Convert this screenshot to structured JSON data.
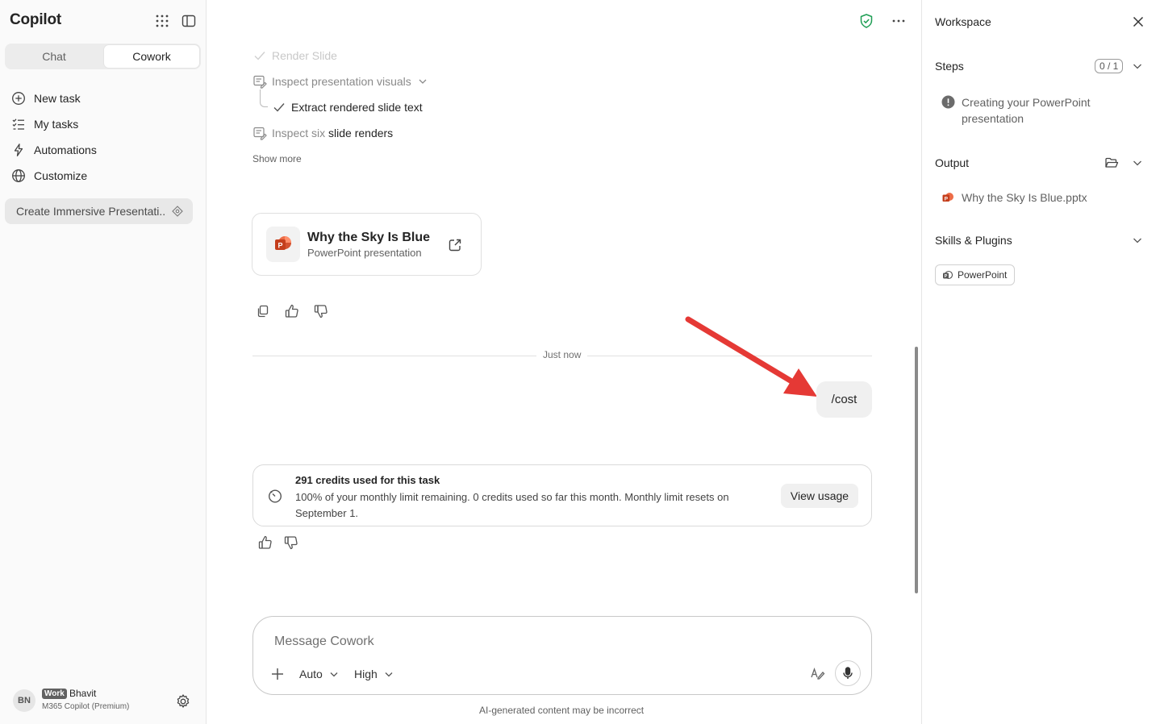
{
  "sidebar": {
    "brand": "Copilot",
    "modes": [
      "Chat",
      "Cowork"
    ],
    "active_mode": "Cowork",
    "nav": [
      {
        "label": "New task",
        "icon": "add-circle-icon"
      },
      {
        "label": "My tasks",
        "icon": "checklist-icon"
      },
      {
        "label": "Automations",
        "icon": "flash-icon"
      },
      {
        "label": "Customize",
        "icon": "globe-icon"
      }
    ],
    "history": [
      {
        "label": "Create Immersive Presentati..."
      }
    ],
    "user": {
      "initials": "BN",
      "badge": "Work",
      "name": "Bhavit",
      "plan": "M365 Copilot (Premium)"
    }
  },
  "main": {
    "steps": [
      {
        "label": "Render Slide",
        "state": "faded"
      },
      {
        "label": "Inspect presentation visuals",
        "state": "expandable"
      },
      {
        "label": "Extract rendered slide text",
        "state": "done"
      },
      {
        "prefix": "Inspect six",
        "label": "slide renders",
        "state": "active"
      }
    ],
    "show_more": "Show more",
    "file": {
      "title": "Why the Sky Is Blue",
      "subtitle": "PowerPoint presentation"
    },
    "divider_label": "Just now",
    "user_message": "/cost",
    "credits": {
      "title": "291 credits used for this task",
      "text": "100% of your monthly limit remaining. 0 credits used so far this month. Monthly limit resets on September 1.",
      "button": "View usage"
    },
    "composer": {
      "placeholder": "Message Cowork",
      "model": "Auto",
      "effort": "High"
    },
    "disclaimer": "AI-generated content may be incorrect"
  },
  "workspace": {
    "title": "Workspace",
    "steps_label": "Steps",
    "steps_counter": "0 / 1",
    "step_item": "Creating your PowerPoint presentation",
    "output_label": "Output",
    "output_file": "Why the Sky Is Blue.pptx",
    "skills_label": "Skills & Plugins",
    "plugin": "PowerPoint"
  },
  "colors": {
    "accent_red": "#e53935",
    "shield_green": "#1e9e54",
    "ppt_red": "#c43e1c"
  }
}
